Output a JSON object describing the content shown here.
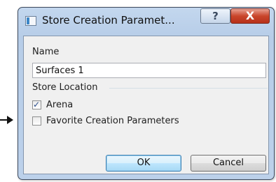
{
  "window": {
    "title": "Store Creation Paramet...",
    "help_glyph": "?",
    "close_glyph": "X"
  },
  "form": {
    "name_label": "Name",
    "name_value": "Surfaces 1",
    "store_location_label": "Store Location",
    "arena_label": "Arena",
    "arena_checked": true,
    "favorite_label": "Favorite Creation Parameters",
    "favorite_checked": false,
    "check_glyph": "✓"
  },
  "buttons": {
    "ok_label": "OK",
    "cancel_label": "Cancel"
  }
}
